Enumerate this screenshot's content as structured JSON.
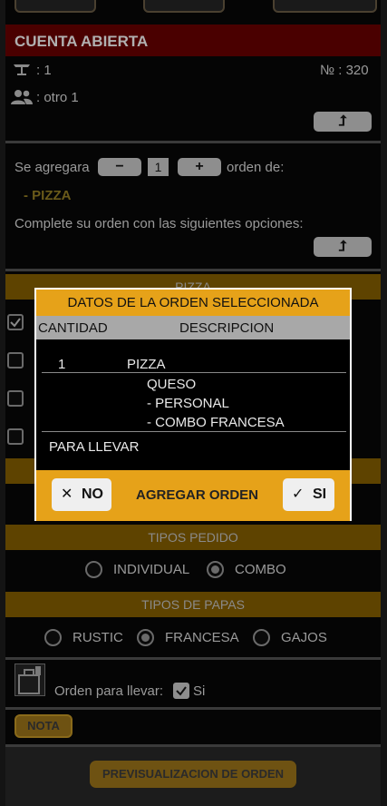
{
  "header": {
    "title": "CUENTA ABIERTA"
  },
  "info": {
    "table_value": ": 1",
    "order_number": "№ : 320",
    "customer_value": ": otro 1",
    "expand_symbol": "⮥"
  },
  "quantity": {
    "prefix": "Se agregara",
    "minus": "−",
    "value": "1",
    "plus": "+",
    "suffix": "orden de:",
    "item": "- PIZZA",
    "options_prompt": "Complete su orden con las siguientes opciones:"
  },
  "background_band": {
    "label": "PIZZA"
  },
  "modal": {
    "title": "DATOS DE LA ORDEN SELECCIONADA",
    "col_quantity": "CANTIDAD",
    "col_description": "DESCRIPCION",
    "row_qty": "1",
    "row_item": "PIZZA",
    "detail1": "QUESO",
    "detail2": "- PERSONAL",
    "detail3": "- COMBO  FRANCESA",
    "takeaway": "PARA LLEVAR",
    "no_icon": "✕",
    "no_label": "NO",
    "center_label": "AGREGAR ORDEN",
    "yes_icon": "✓",
    "yes_label": "SI"
  },
  "tipos_pedido": {
    "label": "TIPOS PEDIDO",
    "options": [
      "INDIVIDUAL",
      "COMBO"
    ],
    "selected": "COMBO"
  },
  "tipos_papas": {
    "label": "TIPOS DE PAPAS",
    "options": [
      "RUSTIC",
      "FRANCESA",
      "GAJOS"
    ],
    "selected": "FRANCESA"
  },
  "takeaway": {
    "label": "Orden para llevar:",
    "checked": true,
    "value": "Si"
  },
  "note_button": "NOTA",
  "preview_button": "PREVISUALIZACION DE ORDEN",
  "colors": {
    "accent": "#e6a219",
    "header": "#4a0000",
    "overlay": "#050505"
  }
}
